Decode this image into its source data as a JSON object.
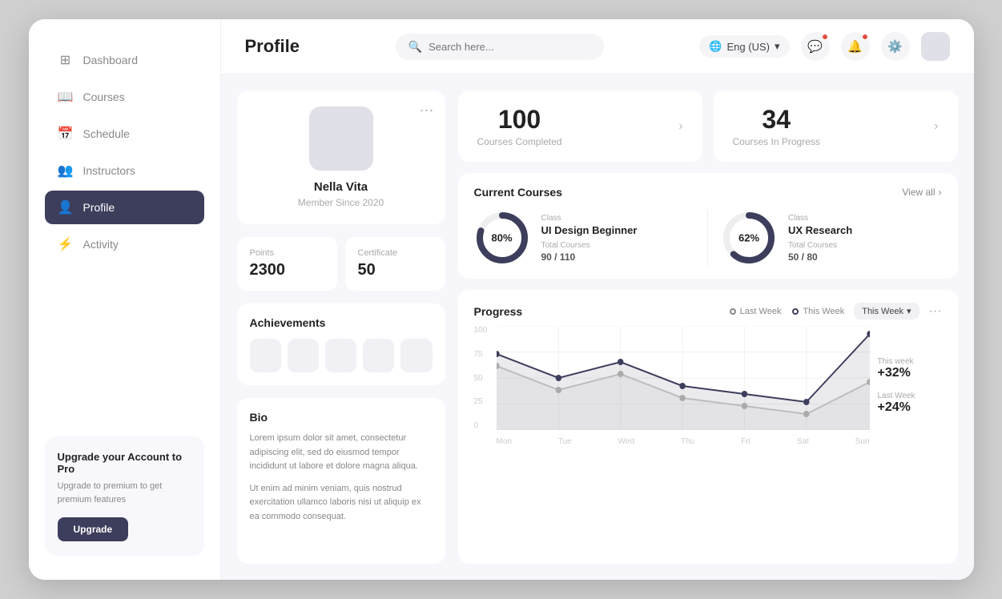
{
  "header": {
    "title": "Profile",
    "search_placeholder": "Search here...",
    "language": "Eng (US)",
    "language_chevron": "▾"
  },
  "sidebar": {
    "items": [
      {
        "id": "dashboard",
        "label": "Dashboard",
        "icon": "⊞",
        "active": false
      },
      {
        "id": "courses",
        "label": "Courses",
        "icon": "📖",
        "active": false
      },
      {
        "id": "schedule",
        "label": "Schedule",
        "icon": "📅",
        "active": false
      },
      {
        "id": "instructors",
        "label": "Instructors",
        "icon": "👥",
        "active": false
      },
      {
        "id": "profile",
        "label": "Profile",
        "icon": "👤",
        "active": true
      },
      {
        "id": "activity",
        "label": "Activity",
        "icon": "⚡",
        "active": false
      }
    ],
    "upgrade_card": {
      "title": "Upgrade your Account to Pro",
      "description": "Upgrade to premium to get premium features",
      "button_label": "Upgrade"
    }
  },
  "profile": {
    "name": "Nella Vita",
    "member_since": "Member Since 2020",
    "points_label": "Points",
    "points_value": "2300",
    "certificate_label": "Certificate",
    "certificate_value": "50",
    "achievements_title": "Achievements",
    "bio_title": "Bio",
    "bio_text1": "Lorem ipsum dolor sit amet, consectetur adipiscing elit, sed do eiusmod tempor incididunt ut labore et dolore magna aliqua.",
    "bio_text2": "Ut enim ad minim veniam, quis nostrud exercitation ullamco laboris nisi ut aliquip ex ea commodo consequat."
  },
  "stats": {
    "courses_completed": "100",
    "courses_completed_label": "Courses Completed",
    "courses_in_progress": "34",
    "courses_in_progress_label": "Courses In Progress"
  },
  "current_courses": {
    "title": "Current Courses",
    "view_all": "View all",
    "courses": [
      {
        "class_label": "Class",
        "name": "UI Design Beginner",
        "total_label": "Total Courses",
        "progress_text": "90 / 110",
        "percent": 80,
        "percent_label": "80%"
      },
      {
        "class_label": "Class",
        "name": "UX Research",
        "total_label": "Total Courses",
        "progress_text": "50 / 80",
        "percent": 62,
        "percent_label": "62%"
      }
    ]
  },
  "progress": {
    "title": "Progress",
    "legend_last_week": "Last Week",
    "legend_this_week": "This Week",
    "week_selector": "This Week",
    "this_week_label": "This week",
    "this_week_value": "+32%",
    "last_week_label": "Last Week",
    "last_week_value": "+24%",
    "y_labels": [
      "100",
      "75",
      "50",
      "25",
      "0"
    ],
    "x_labels": [
      "Mon",
      "Tue",
      "Wed",
      "Thu",
      "Fri",
      "Sat",
      "Sun"
    ]
  }
}
